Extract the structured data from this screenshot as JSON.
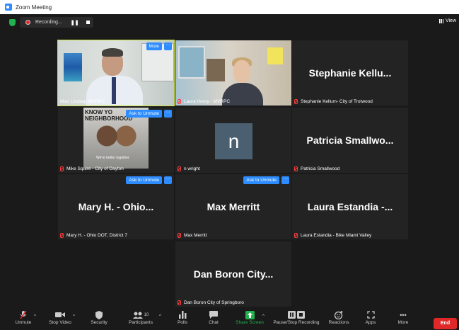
{
  "window": {
    "title": "Zoom Meeting"
  },
  "topbar": {
    "recording_label": "Recording...",
    "view_label": "View"
  },
  "tiles": [
    {
      "name": "Matt Lindsay, MVRPC",
      "muted": false,
      "overlay_button": "Mute",
      "overlay_more": "···"
    },
    {
      "name": "Laura Henry - MVRPC",
      "muted": true
    },
    {
      "name": "Stephanie Kellum- City of Trotwood",
      "display": "Stephanie Kellu...",
      "muted": true
    },
    {
      "name": "Mike Squire - City of Dayton",
      "muted": true,
      "overlay_button": "Ask to Unmute",
      "overlay_more": "···",
      "image_text": "KNOW YO NEIGHBORHOOD",
      "image_tag": "We're better together"
    },
    {
      "name": "n wright",
      "avatar": "n",
      "muted": true
    },
    {
      "name": "Patricia Smallwood",
      "display": "Patricia Smallwo...",
      "muted": true
    },
    {
      "name": "Mary H. - Ohio DOT, District 7",
      "display": "Mary H. - Ohio...",
      "muted": true,
      "overlay_button": "Ask to Unmute",
      "overlay_more": "···"
    },
    {
      "name": "Max Merritt",
      "display": "Max Merritt",
      "muted": true,
      "overlay_button": "Ask to Unmute",
      "overlay_more": "···"
    },
    {
      "name": "Laura Estandia - Bike Miami Valley",
      "display": "Laura Estandia -...",
      "muted": true
    },
    {
      "name": "Dan Boron City of Springboro",
      "display": "Dan Boron City...",
      "muted": true
    }
  ],
  "toolbar": {
    "unmute": "Unmute",
    "stop_video": "Stop Video",
    "security": "Security",
    "participants": "Participants",
    "participants_count": "10",
    "polls": "Polls",
    "chat": "Chat",
    "share_screen": "Share Screen",
    "pause_stop_recording": "Pause/Stop Recording",
    "reactions": "Reactions",
    "apps": "Apps",
    "more": "More",
    "end": "End"
  },
  "colors": {
    "active_speaker_border": "#c6e240",
    "accent_blue": "#2d8cff",
    "end_red": "#e02828",
    "share_green": "#22b14c"
  }
}
